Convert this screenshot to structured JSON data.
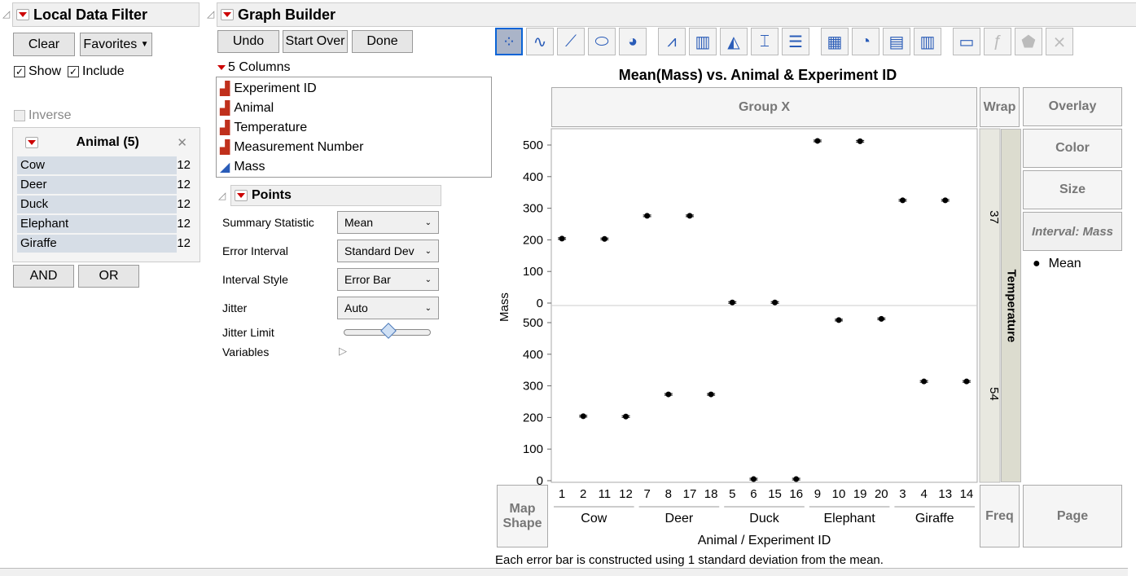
{
  "filter": {
    "title": "Local Data Filter",
    "clear": "Clear",
    "favorites": "Favorites",
    "show": "Show",
    "include": "Include",
    "inverse": "Inverse",
    "card_title": "Animal (5)",
    "items": [
      {
        "name": "Cow",
        "count": "12"
      },
      {
        "name": "Deer",
        "count": "12"
      },
      {
        "name": "Duck",
        "count": "12"
      },
      {
        "name": "Elephant",
        "count": "12"
      },
      {
        "name": "Giraffe",
        "count": "12"
      }
    ],
    "and": "AND",
    "or": "OR"
  },
  "builder": {
    "title": "Graph Builder",
    "undo": "Undo",
    "start_over": "Start Over",
    "done": "Done",
    "columns_label": "5 Columns",
    "columns": [
      {
        "name": "Experiment ID",
        "type": "nominal"
      },
      {
        "name": "Animal",
        "type": "nominal"
      },
      {
        "name": "Temperature",
        "type": "nominal"
      },
      {
        "name": "Measurement Number",
        "type": "nominal"
      },
      {
        "name": "Mass",
        "type": "continuous"
      }
    ],
    "points": {
      "title": "Points",
      "rows": [
        {
          "label": "Summary Statistic",
          "value": "Mean"
        },
        {
          "label": "Error Interval",
          "value": "Standard Dev"
        },
        {
          "label": "Interval Style",
          "value": "Error Bar"
        },
        {
          "label": "Jitter",
          "value": "Auto"
        }
      ],
      "jitter_limit": "Jitter Limit",
      "jitter_limit_value": 0.5,
      "variables": "Variables"
    },
    "toolbar": [
      "points",
      "smoother",
      "line-of-fit",
      "ellipse",
      "contour",
      "line",
      "bar",
      "area",
      "box-plot",
      "histogram",
      "heatmap",
      "pie",
      "treemap",
      "mosaic",
      "caption-box",
      "formula",
      "map-shapes",
      "parallel"
    ],
    "zones": {
      "group_x": "Group X",
      "wrap": "Wrap",
      "overlay": "Overlay",
      "color": "Color",
      "size": "Size",
      "interval": "Interval: Mass",
      "legend_mean": "Mean",
      "map_shape": "Map Shape",
      "freq": "Freq",
      "page": "Page"
    },
    "footnote": "Each error bar is constructed using 1 standard deviation from the mean."
  },
  "chart_data": {
    "type": "scatter",
    "title": "Mean(Mass) vs. Animal & Experiment ID",
    "xlabel": "Animal / Experiment ID",
    "ylabel": "Mass",
    "group_y_label": "Temperature",
    "ylim": [
      0,
      500
    ],
    "yticks": [
      "0",
      "100",
      "200",
      "300",
      "400",
      "500"
    ],
    "categories": [
      "1",
      "2",
      "11",
      "12",
      "7",
      "8",
      "17",
      "18",
      "5",
      "6",
      "15",
      "16",
      "9",
      "10",
      "19",
      "20",
      "3",
      "4",
      "13",
      "14"
    ],
    "groups": [
      {
        "name": "Cow",
        "n": 4
      },
      {
        "name": "Deer",
        "n": 4
      },
      {
        "name": "Duck",
        "n": 4
      },
      {
        "name": "Elephant",
        "n": 4
      },
      {
        "name": "Giraffe",
        "n": 4
      }
    ],
    "panels": [
      {
        "name": "37",
        "points": {
          "1": 204,
          "11": 203,
          "7": 276,
          "17": 276,
          "5": 2,
          "15": 2,
          "9": 513,
          "19": 512,
          "3": 325,
          "13": 325
        }
      },
      {
        "name": "54",
        "points": {
          "2": 204,
          "12": 203,
          "8": 273,
          "18": 273,
          "6": 5,
          "16": 5,
          "10": 508,
          "20": 512,
          "4": 314,
          "14": 314
        }
      }
    ]
  }
}
